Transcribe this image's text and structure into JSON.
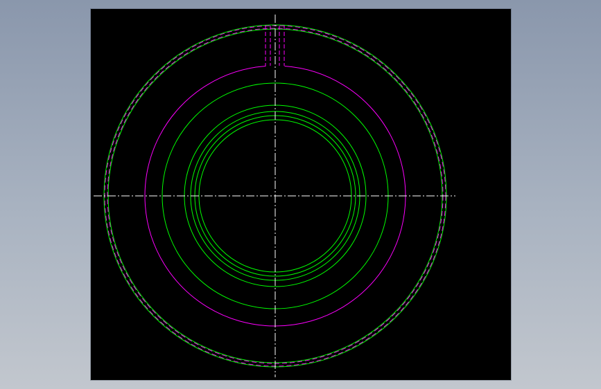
{
  "drawing": {
    "view": "front",
    "background_color": "#000000",
    "colors": {
      "outline": "#00ff00",
      "hidden_line": "#ff00ff",
      "centerline": "#ffffff"
    },
    "line_styles": {
      "outline": "solid",
      "hidden_line": "dashed",
      "centerline": "dash-dot"
    },
    "concentric_circles": [
      {
        "id": "outer-edge",
        "kind": "outline"
      },
      {
        "id": "outer-edge-inner",
        "kind": "outline"
      },
      {
        "id": "hidden-bore-outer",
        "kind": "hidden_line"
      },
      {
        "id": "pitch-circle",
        "kind": "outline"
      },
      {
        "id": "shoulder-outer",
        "kind": "outline"
      },
      {
        "id": "shoulder-inner",
        "kind": "outline"
      },
      {
        "id": "bore-outer",
        "kind": "outline"
      },
      {
        "id": "bore-inner",
        "kind": "outline"
      }
    ],
    "features": [
      "dashed-rim-band",
      "keyway-slot",
      "horizontal-centerline",
      "vertical-centerline"
    ]
  }
}
